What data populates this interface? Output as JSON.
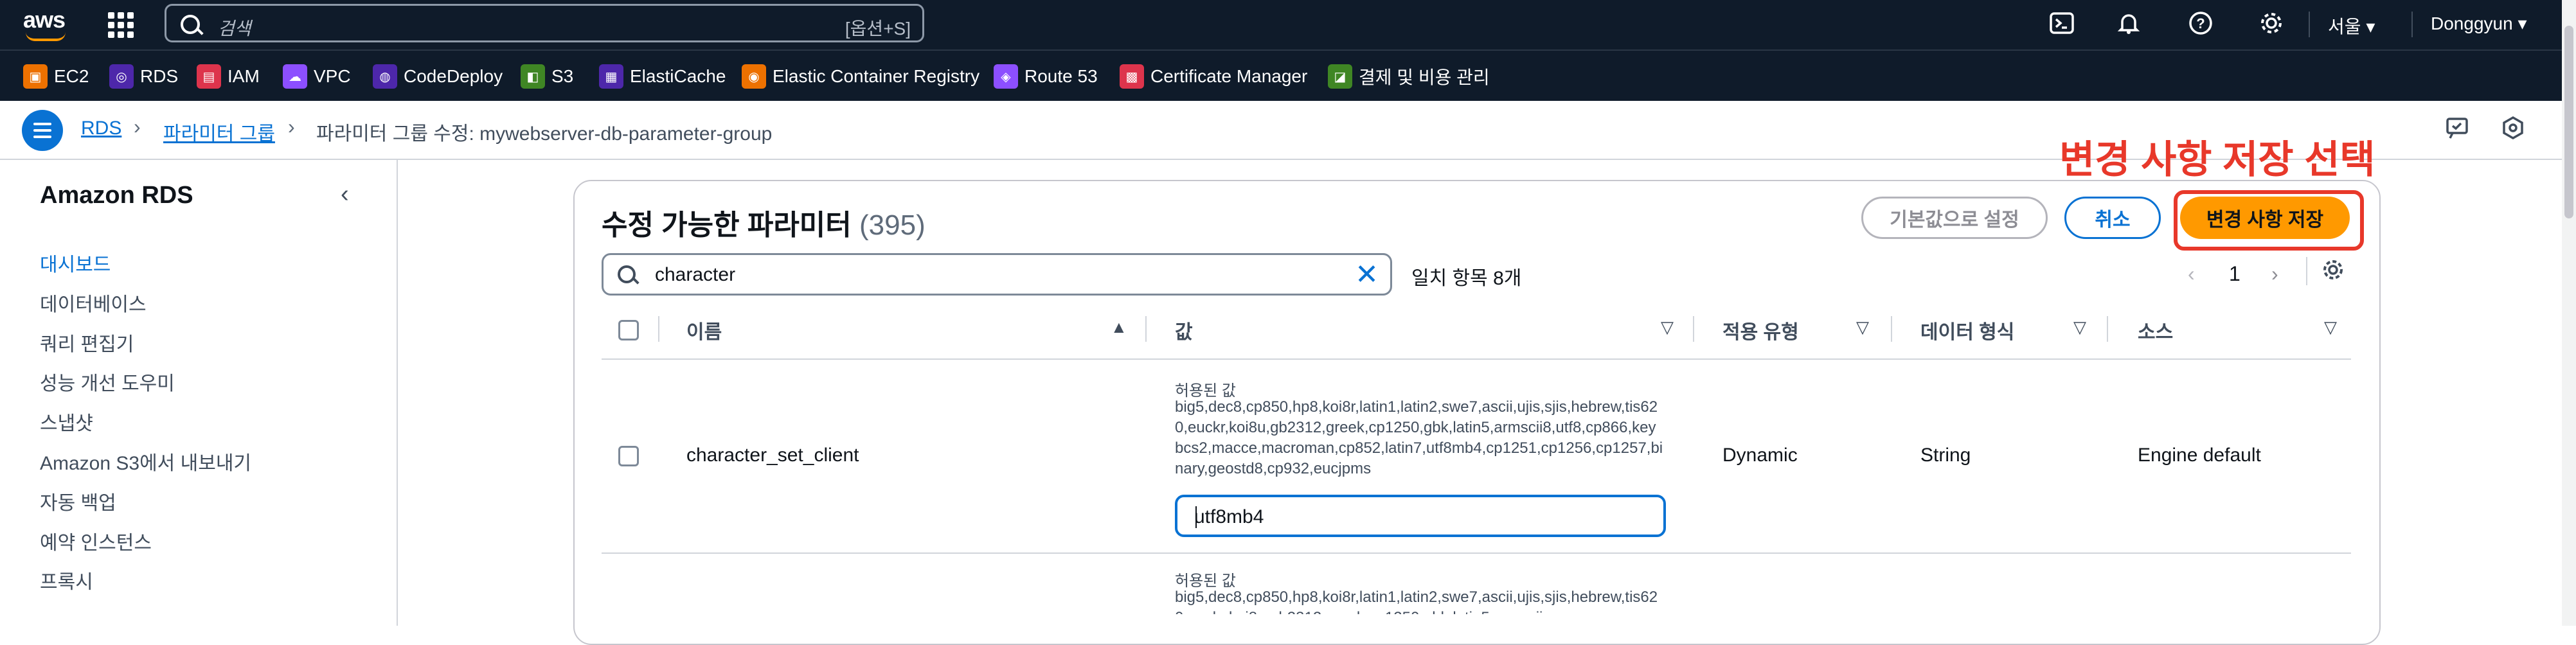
{
  "topnav": {
    "logo_text": "aws",
    "search_placeholder": "검색",
    "search_shortcut": "[옵션+S]",
    "region": "서울",
    "user": "Donggyun",
    "icons": [
      "apps-grid-icon",
      "cloudshell-icon",
      "bell-icon",
      "help-icon",
      "gear-icon"
    ]
  },
  "favorites": [
    {
      "label": "EC2",
      "color": "#ed7100"
    },
    {
      "label": "RDS",
      "color": "#4d27aa"
    },
    {
      "label": "IAM",
      "color": "#dd344c"
    },
    {
      "label": "VPC",
      "color": "#8c4fff"
    },
    {
      "label": "CodeDeploy",
      "color": "#4d27aa"
    },
    {
      "label": "S3",
      "color": "#3f8624"
    },
    {
      "label": "ElastiCache",
      "color": "#4d27aa"
    },
    {
      "label": "Elastic Container Registry",
      "color": "#ed7100"
    },
    {
      "label": "Route 53",
      "color": "#8c4fff"
    },
    {
      "label": "Certificate Manager",
      "color": "#dd344c"
    },
    {
      "label": "결제 및 비용 관리",
      "color": "#3f8624"
    }
  ],
  "breadcrumb": {
    "items": [
      "RDS",
      "파라미터 그룹",
      "파라미터 그룹 수정: mywebserver-db-parameter-group"
    ]
  },
  "sidebar": {
    "title": "Amazon RDS",
    "items": [
      "대시보드",
      "데이터베이스",
      "쿼리 편집기",
      "성능 개선 도우미",
      "스냅샷",
      "Amazon S3에서 내보내기",
      "자동 백업",
      "예약 인스턴스",
      "프록시"
    ]
  },
  "annotation": "변경 사항 저장 선택",
  "panel": {
    "title": "수정 가능한 파라미터",
    "count": "(395)",
    "buttons": {
      "reset": "기본값으로 설정",
      "cancel": "취소",
      "save": "변경 사항 저장"
    },
    "filter_value": "character",
    "match_text": "일치 항목 8개",
    "page": "1",
    "columns": [
      "이름",
      "값",
      "적용 유형",
      "데이터 형식",
      "소스"
    ],
    "rows": [
      {
        "name": "character_set_client",
        "allowed_label": "허용된 값",
        "allowed": "big5,dec8,cp850,hp8,koi8r,latin1,latin2,swe7,ascii,ujis,sjis,hebrew,tis620,euckr,koi8u,gb2312,greek,cp1250,gbk,latin5,armscii8,utf8,cp866,keybcs2,macce,macroman,cp852,latin7,utf8mb4,cp1251,cp1256,cp1257,binary,geostd8,cp932,eucjpms",
        "value": "utf8mb4",
        "apply_type": "Dynamic",
        "data_type": "String",
        "source": "Engine default"
      },
      {
        "allowed_label": "허용된 값",
        "allowed": "big5,dec8,cp850,hp8,koi8r,latin1,latin2,swe7,ascii,ujis,sjis,hebrew,tis620,euckr,koi8u,gb2312,greek,cp1250,gbk,latin5,armscii"
      }
    ]
  }
}
